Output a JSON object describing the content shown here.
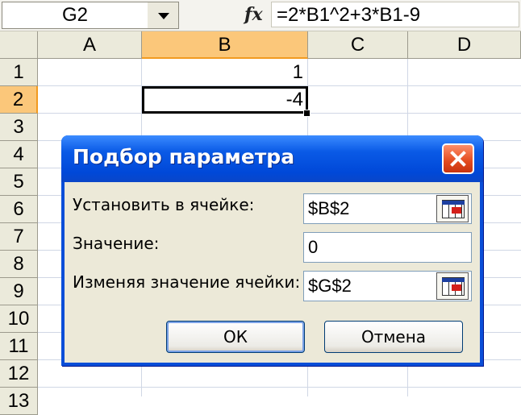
{
  "formula_bar": {
    "name_box": "G2",
    "fx_icon": "fx",
    "formula": "=2*B1^2+3*B1-9"
  },
  "columns": [
    "A",
    "B",
    "C",
    "D"
  ],
  "rows": [
    "1",
    "2",
    "3",
    "4",
    "5",
    "6",
    "7",
    "8",
    "9",
    "10",
    "11",
    "12",
    "13"
  ],
  "cells": {
    "B1": "1",
    "B2": "-4"
  },
  "dialog": {
    "title": "Подбор параметра",
    "set_cell_label": "Установить в ячейке:",
    "set_cell_value": "$B$2",
    "value_label": "Значение:",
    "value_value": "0",
    "changing_cell_label": "Изменяя значение ячейки:",
    "changing_cell_value": "$G$2",
    "ok_label": "ОК",
    "cancel_label": "Отмена"
  },
  "colors": {
    "selected_header": "#fbc77a",
    "dialog_title_bar": "#0a5ae6",
    "dialog_body": "#ece9d8"
  }
}
